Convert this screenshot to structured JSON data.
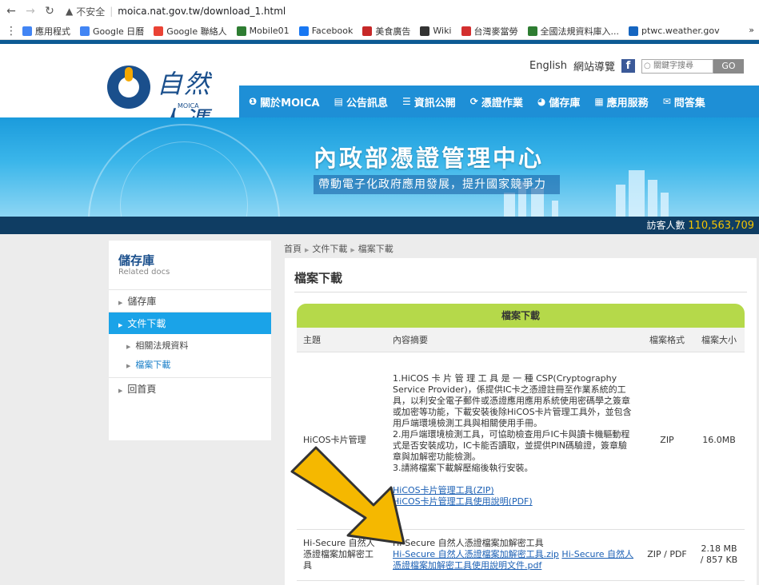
{
  "browser": {
    "back_icon": "arrow-left-icon",
    "insecure_label": "不安全",
    "url": "moica.nat.gov.tw/download_1.html",
    "bookmarks": [
      {
        "label": "應用程式",
        "color": "#4285f4"
      },
      {
        "label": "Google 日曆",
        "color": "#4285f4"
      },
      {
        "label": "Google 聯絡人",
        "color": "#ea4335"
      },
      {
        "label": "Mobile01",
        "color": "#2e7d32"
      },
      {
        "label": "Facebook",
        "color": "#1877f2"
      },
      {
        "label": "美食廣告",
        "color": "#c62828"
      },
      {
        "label": "Wiki",
        "color": "#333333"
      },
      {
        "label": "台灣麥當勞",
        "color": "#d32f2f"
      },
      {
        "label": "全國法規資料庫入...",
        "color": "#2e7d32"
      },
      {
        "label": "ptwc.weather.gov",
        "color": "#1565c0"
      }
    ],
    "more": "»"
  },
  "header": {
    "logo_text": "自然人憑證",
    "logo_sub": "MOICA",
    "english": "English",
    "sitemap": "網站導覽",
    "search_placeholder": "關鍵字搜尋",
    "search_go": "GO",
    "nav": [
      {
        "label": "關於MOICA",
        "icon": "info-icon",
        "glyph": "❶"
      },
      {
        "label": "公告訊息",
        "icon": "document-icon",
        "glyph": "▤"
      },
      {
        "label": "資訊公開",
        "icon": "list-icon",
        "glyph": "☰"
      },
      {
        "label": "憑證作業",
        "icon": "refresh-icon",
        "glyph": "⟳"
      },
      {
        "label": "儲存庫",
        "icon": "pie-chart-icon",
        "glyph": "◕"
      },
      {
        "label": "應用服務",
        "icon": "grid-icon",
        "glyph": "▦"
      },
      {
        "label": "問答集",
        "icon": "chat-icon",
        "glyph": "✉"
      }
    ]
  },
  "banner": {
    "title": "內政部憑證管理中心",
    "slogan": "帶動電子化政府應用發展，提升國家競爭力",
    "visitor_label": "訪客人數",
    "visitor_count": "110,563,709"
  },
  "sidebar": {
    "title": "儲存庫",
    "subtitle": "Related docs",
    "items": [
      {
        "label": "儲存庫"
      },
      {
        "label": "文件下載"
      },
      {
        "label": "相關法規資料"
      },
      {
        "label": "檔案下載"
      },
      {
        "label": "回首頁"
      }
    ]
  },
  "breadcrumb": [
    "首頁",
    "文件下載",
    "檔案下載"
  ],
  "panel": {
    "title": "檔案下載",
    "table_caption": "檔案下載",
    "columns": [
      "主題",
      "內容摘要",
      "檔案格式",
      "檔案大小"
    ],
    "rows": [
      {
        "topic": "HiCOS卡片管理",
        "desc_lines": [
          "1.HiCOS 卡 片 管 理 工 具 是 一 種 CSP(Cryptography Service Provider)，係提供IC卡之憑證註冊至作業系統的工具，以利安全電子郵件或憑證應用應用系統使用密碼學之簽章或加密等功能，下載安裝後除HiCOS卡片管理工具外，並包含用戶端環境檢測工具與相關使用手冊。",
          "2.用戶端環境檢測工具，可協助檢查用戶IC卡與讀卡機驅動程式是否安裝成功，IC卡能否讀取，並提供PIN碼驗證，簽章驗章與加解密功能檢測。",
          "3.請將檔案下載解壓縮後執行安裝。"
        ],
        "links": [
          "HiCOS卡片管理工具(ZIP)",
          "HiCOS卡片管理工具使用說明(PDF)"
        ],
        "format": "ZIP",
        "size": "16.0MB"
      },
      {
        "topic": "Hi-Secure 自然人憑證檔案加解密工具",
        "desc_title": "Hi-Secure 自然人憑證檔案加解密工具",
        "links": [
          "Hi-Secure 自然人憑證檔案加解密工具.zip",
          "Hi-Secure 自然人憑證檔案加解密工具使用說明文件.pdf"
        ],
        "format": "ZIP / PDF",
        "size": "2.18 MB / 857 KB"
      }
    ]
  },
  "colors": {
    "nav": "#1e8fd6",
    "caption": "#b5d94a",
    "arrow": "#f5b800",
    "sidebar_active": "#1aa3e8"
  }
}
